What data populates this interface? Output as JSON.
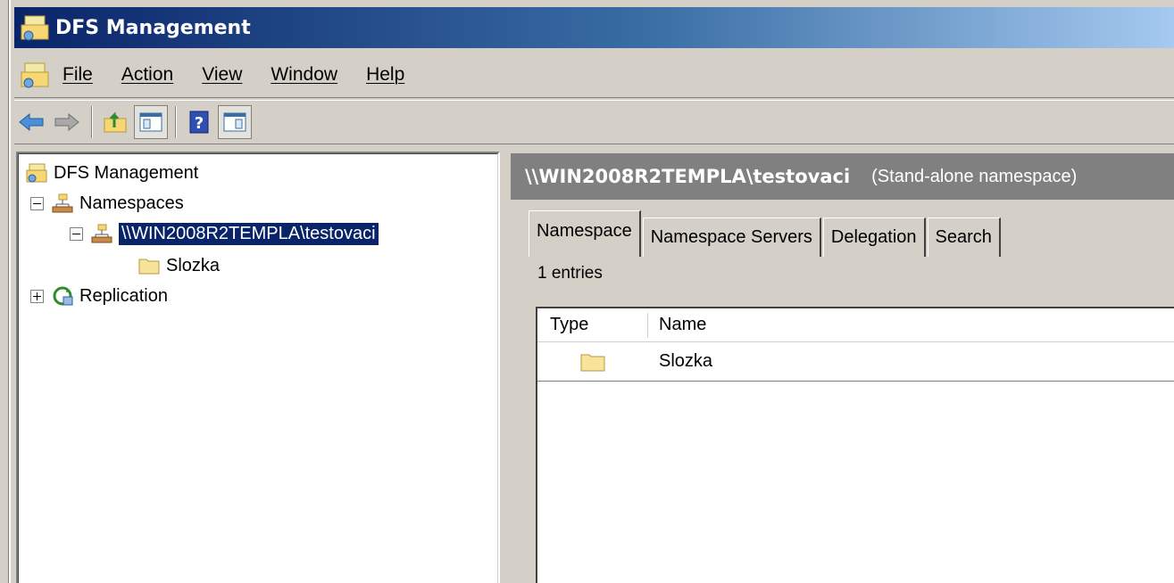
{
  "window": {
    "title": "DFS Management"
  },
  "menu": {
    "items": [
      "File",
      "Action",
      "View",
      "Window",
      "Help"
    ]
  },
  "toolbar": {
    "buttons": [
      "back-icon",
      "forward-icon",
      "up-level-icon",
      "show-hide-console-tree-icon",
      "help-icon",
      "show-hide-action-pane-icon"
    ]
  },
  "tree": {
    "root": "DFS Management",
    "namespaces": "Namespaces",
    "namespace_path": "\\\\WIN2008R2TEMPLA\\testovaci",
    "folder": "Slozka",
    "replication": "Replication"
  },
  "right_pane": {
    "header_path": "\\\\WIN2008R2TEMPLA\\testovaci",
    "header_kind": "(Stand-alone namespace)",
    "tabs": [
      "Namespace",
      "Namespace Servers",
      "Delegation",
      "Search"
    ],
    "active_tab": "Namespace",
    "entries_count": "1 entries",
    "columns": [
      "Type",
      "Name"
    ],
    "rows": [
      {
        "type_icon": "folder-icon",
        "name": "Slozka"
      }
    ]
  },
  "colors": {
    "title_start": "#0a246a",
    "title_end": "#a6caf0",
    "header_bg": "#808080",
    "selection": "#0a246a",
    "chrome": "#d4d0c8"
  }
}
